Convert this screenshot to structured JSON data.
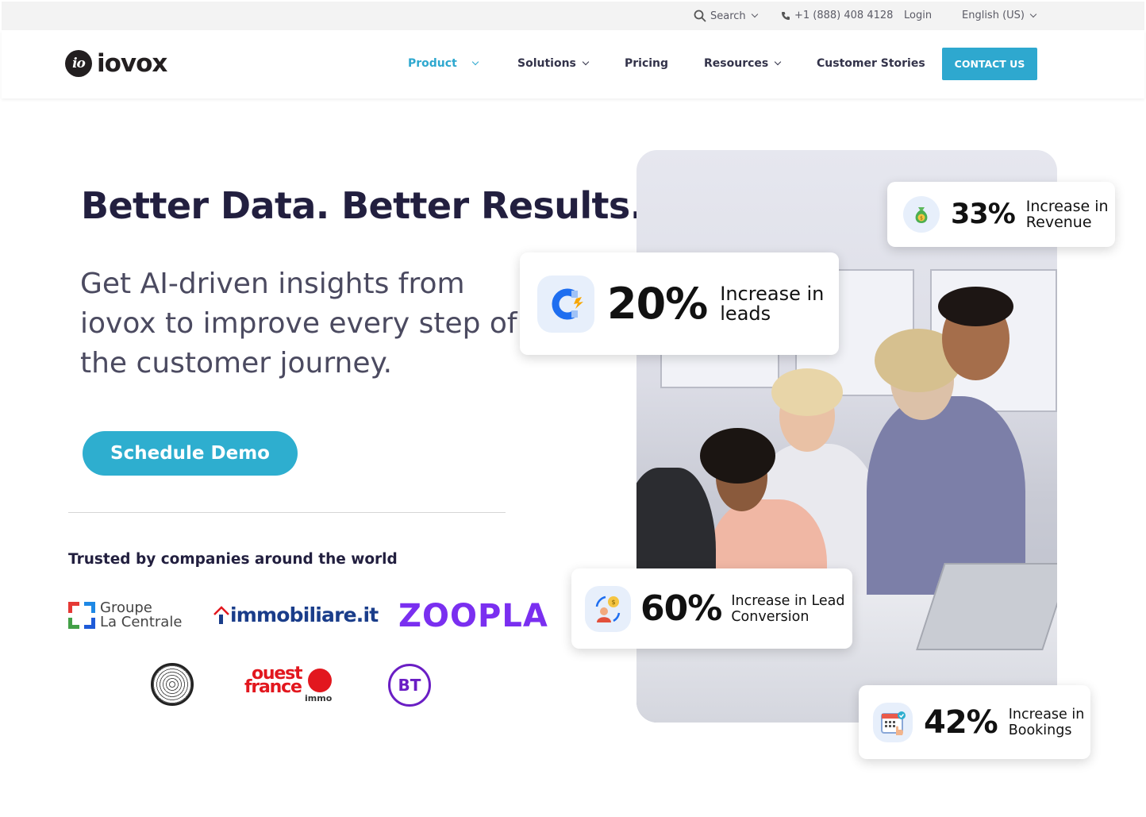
{
  "topbar": {
    "search_label": "Search",
    "phone": "+1 (888) 408 4128",
    "login": "Login",
    "language": "English (US)"
  },
  "nav": {
    "logo_mark": "io",
    "logo_text": "iovox",
    "items": [
      {
        "label": "Product",
        "active": true
      },
      {
        "label": "Solutions"
      },
      {
        "label": "Pricing"
      },
      {
        "label": "Resources"
      },
      {
        "label": "Customer Stories"
      }
    ],
    "contact_label": "CONTACT US"
  },
  "hero": {
    "headline": "Better Data. Better Results.",
    "subheadline": "Get AI-driven insights from iovox to improve every step of the customer journey.",
    "cta_label": "Schedule Demo",
    "trusted_label": "Trusted by companies around the world"
  },
  "clients": {
    "groupe_line1": "Groupe",
    "groupe_line2": "La Centrale",
    "immobiliare": "immobiliare.it",
    "zoopla": "ZOOPLA",
    "ouest_line1": "ouest",
    "ouest_line2": "france",
    "ouest_line3": "immo",
    "bt": "BT"
  },
  "stats": [
    {
      "value": "33%",
      "label": "Increase in Revenue",
      "icon": "money-bag-icon"
    },
    {
      "value": "20%",
      "label": "Increase in leads",
      "icon": "magnet-icon"
    },
    {
      "value": "60%",
      "label": "Increase in Lead Conversion",
      "icon": "conversion-icon"
    },
    {
      "value": "42%",
      "label": "Increase in Bookings",
      "icon": "calendar-icon"
    }
  ],
  "colors": {
    "accent": "#2ea8cf",
    "headline": "#221f3f",
    "zoopla": "#7a2ff0",
    "bt": "#6a1ec4",
    "ouest": "#e2171e"
  }
}
